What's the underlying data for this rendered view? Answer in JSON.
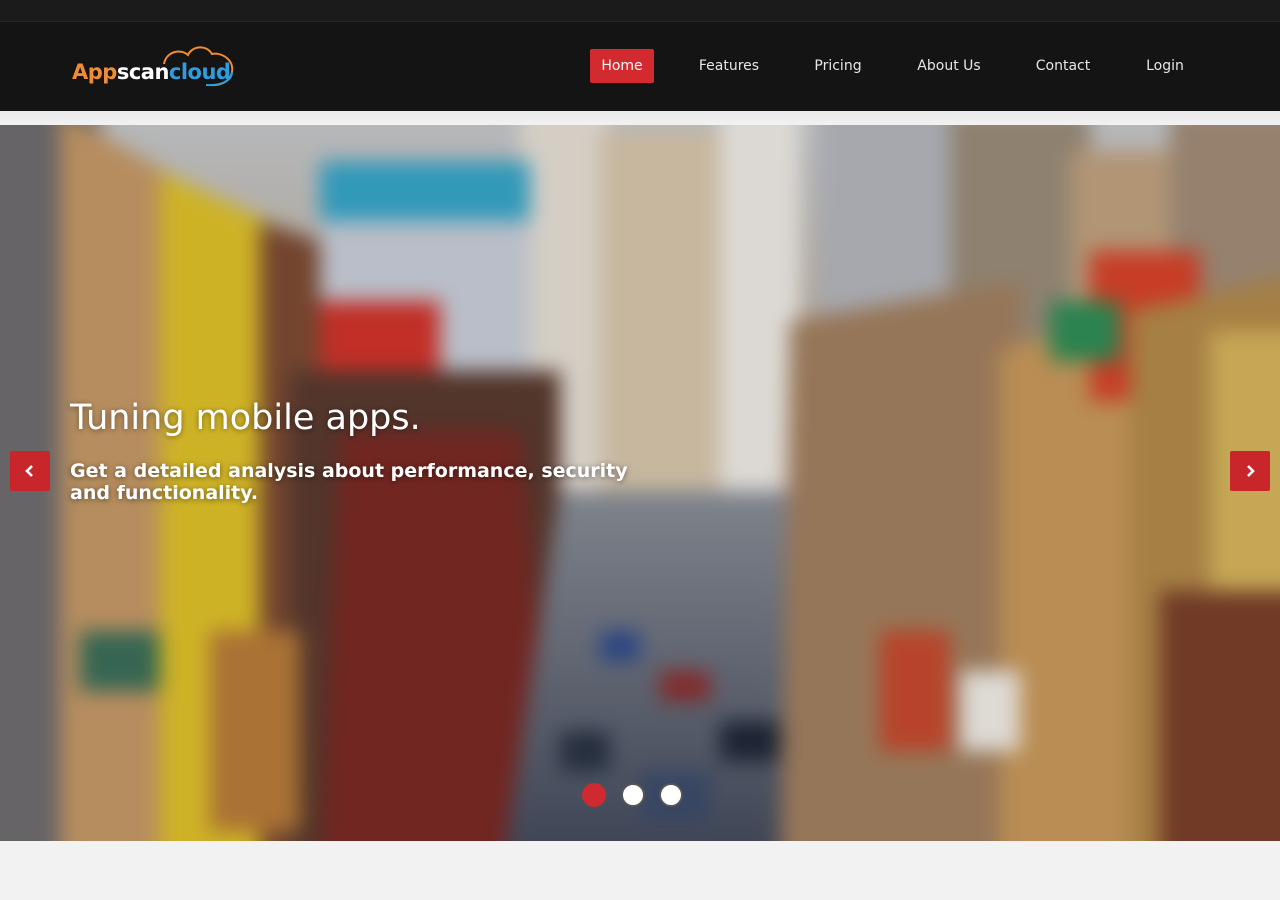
{
  "brand": {
    "part1": "App",
    "part2": "scan",
    "part3": "cloud",
    "colors": {
      "part1": "#f08c34",
      "part2": "#ffffff",
      "part3": "#2e9ce0"
    }
  },
  "nav": {
    "items": [
      {
        "label": "Home",
        "active": true
      },
      {
        "label": "Features",
        "active": false
      },
      {
        "label": "Pricing",
        "active": false
      },
      {
        "label": "About Us",
        "active": false
      },
      {
        "label": "Contact",
        "active": false
      },
      {
        "label": "Login",
        "active": false
      }
    ],
    "active_color": "#d32a2f"
  },
  "hero": {
    "title": "Tuning mobile apps.",
    "subtitle": "Get a detailed analysis about performance, security and functionality.",
    "prev_icon": "chevron-left-icon",
    "next_icon": "chevron-right-icon",
    "slides_total": 3,
    "current_slide": 1,
    "accent_color": "#c9262b"
  }
}
